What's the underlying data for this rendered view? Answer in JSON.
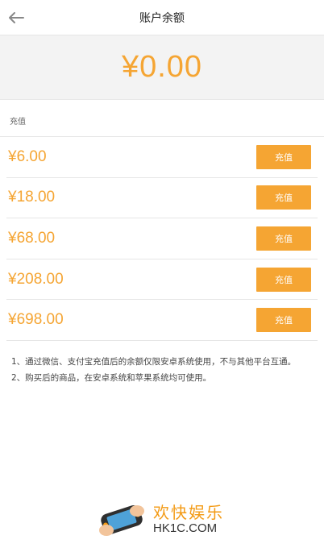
{
  "header": {
    "title": "账户余额",
    "back_icon": "arrow-left-icon"
  },
  "balance": {
    "amount": "¥0.00"
  },
  "section": {
    "label": "充值"
  },
  "recharge_options": [
    {
      "price": "¥6.00",
      "button": "充值"
    },
    {
      "price": "¥18.00",
      "button": "充值"
    },
    {
      "price": "¥68.00",
      "button": "充值"
    },
    {
      "price": "¥208.00",
      "button": "充值"
    },
    {
      "price": "¥698.00",
      "button": "充值"
    }
  ],
  "notes": [
    "1、通过微信、支付宝充值后的余额仅限安卓系统使用，不与其他平台互通。",
    "2、购买后的商品，在安卓系统和苹果系统均可使用。"
  ],
  "watermark": {
    "cn": "欢快娱乐",
    "en": "HK1C.COM"
  },
  "colors": {
    "accent": "#f5a533",
    "background": "#ffffff",
    "balance_bg": "#f3f3f3"
  }
}
